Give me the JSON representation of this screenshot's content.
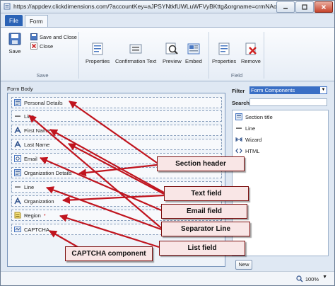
{
  "window": {
    "url": "https://appdev.clickdimensions.com/?accountKey=aJPSYNtkfUWLuWFVyBKttg&orgname=crmNAorgdeadc..."
  },
  "tabs": [
    {
      "label": "File"
    },
    {
      "label": "Form"
    }
  ],
  "ribbon": {
    "save": {
      "label": "Save"
    },
    "save_and_close": {
      "label": "Save and Close"
    },
    "close": {
      "label": "Close"
    },
    "save_group_label": "Save",
    "form_properties": {
      "label": "Properties"
    },
    "confirmation_text": {
      "label": "Confirmation Text"
    },
    "preview": {
      "label": "Preview"
    },
    "embed": {
      "label": "Embed"
    },
    "field_properties": {
      "label": "Properties"
    },
    "remove": {
      "label": "Remove"
    },
    "field_group_label": "Field"
  },
  "form_body": {
    "title": "Form Body",
    "fields": [
      {
        "label": "Personal Details",
        "icon": "section-icon",
        "required": false
      },
      {
        "label": "Line",
        "icon": "line-icon",
        "required": false
      },
      {
        "label": "First Name",
        "icon": "text-field-icon",
        "required": false
      },
      {
        "label": "Last Name",
        "icon": "text-field-icon",
        "required": false
      },
      {
        "label": "Email",
        "icon": "email-icon",
        "required": false
      },
      {
        "label": "Organization Details",
        "icon": "section-icon",
        "required": false
      },
      {
        "label": "Line",
        "icon": "line-icon",
        "required": false
      },
      {
        "label": "Organization",
        "icon": "text-field-icon",
        "required": false
      },
      {
        "label": "Region",
        "icon": "list-field-icon",
        "required": true,
        "required_mark": "*"
      },
      {
        "label": "CAPTCHA",
        "icon": "captcha-icon",
        "required": false
      }
    ]
  },
  "right_panel": {
    "filter_label": "Filter",
    "filter_value": "Form Components",
    "search_label": "Search",
    "search_value": "",
    "components": [
      {
        "label": "Section title",
        "icon": "section-icon"
      },
      {
        "label": "Line",
        "icon": "line-icon"
      },
      {
        "label": "Wizard",
        "icon": "wizard-icon"
      },
      {
        "label": "HTML",
        "icon": "html-icon"
      }
    ],
    "new_button": "New"
  },
  "statusbar": {
    "zoom": "100%"
  },
  "callouts": [
    {
      "label": "Section header"
    },
    {
      "label": "Text field"
    },
    {
      "label": "Email field"
    },
    {
      "label": "Separator Line"
    },
    {
      "label": "List field"
    },
    {
      "label": "CAPTCHA component"
    }
  ],
  "colors": {
    "accent": "#2b63b6",
    "callout_border": "#7d1010",
    "callout_fill": "#f9e6e6",
    "arrow": "#c0141e"
  }
}
